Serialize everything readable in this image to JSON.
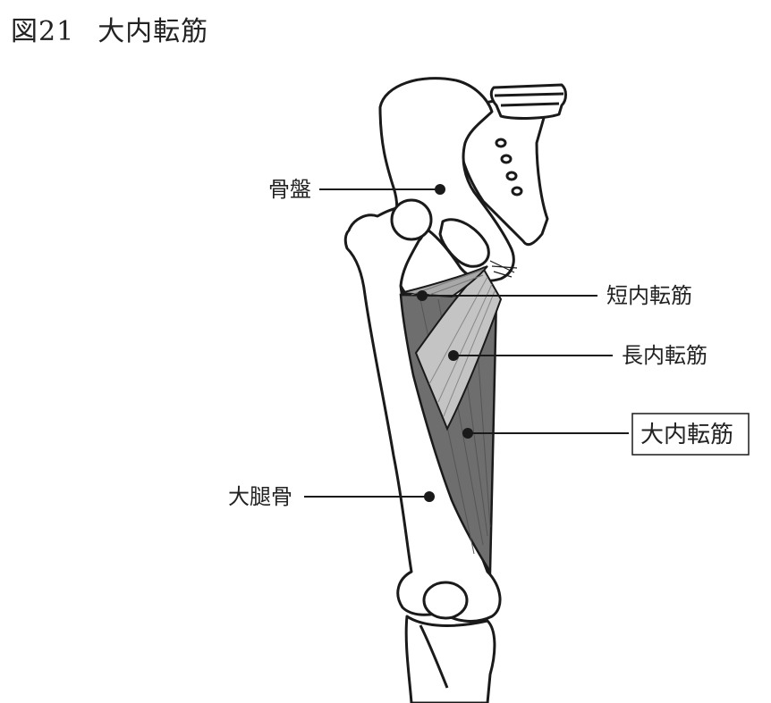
{
  "title": {
    "number": "図21",
    "text": "大内転筋"
  },
  "labels": {
    "pelvis": "骨盤",
    "adductor_brevis": "短内転筋",
    "adductor_longus": "長内転筋",
    "adductor_magnus": "大内転筋",
    "femur": "大腿骨"
  },
  "colors": {
    "outline": "#1a1a1a",
    "bone_fill": "#ffffff",
    "adductor_magnus": "#6e6e6e",
    "adductor_longus": "#c4c4c4",
    "adductor_brevis": "#a8a8a8"
  }
}
